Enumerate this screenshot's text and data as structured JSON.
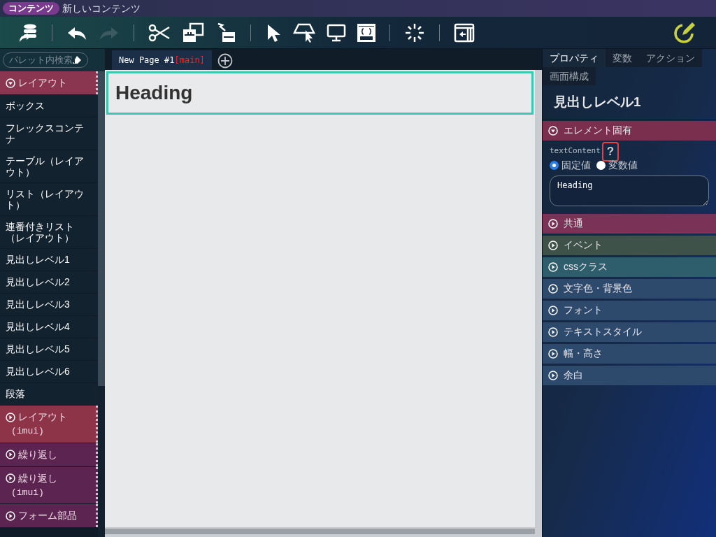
{
  "title_bar": {
    "badge": "コンテンツ",
    "title": "新しいコンテンツ"
  },
  "toolbar": [
    {
      "kind": "export"
    },
    {
      "kind": "separator"
    },
    {
      "kind": "undo",
      "disabled": false
    },
    {
      "kind": "redo",
      "disabled": true
    },
    {
      "kind": "separator"
    },
    {
      "kind": "cut"
    },
    {
      "kind": "copy"
    },
    {
      "kind": "paste"
    },
    {
      "kind": "separator"
    },
    {
      "kind": "pointer"
    },
    {
      "kind": "area-select"
    },
    {
      "kind": "monitor"
    },
    {
      "kind": "css"
    },
    {
      "kind": "separator"
    },
    {
      "kind": "loading"
    },
    {
      "kind": "separator"
    },
    {
      "kind": "panel"
    }
  ],
  "palette": {
    "search_placeholder": "パレット内検索",
    "items": [
      {
        "kind": "category",
        "label": "レイアウト",
        "expanded": true,
        "color": "#8a3650"
      },
      {
        "kind": "item",
        "label": "ボックス"
      },
      {
        "kind": "item",
        "label": "フレックスコンテナ"
      },
      {
        "kind": "item",
        "label": "テーブル（レイアウト）"
      },
      {
        "kind": "item",
        "label": "リスト（レイアウト）"
      },
      {
        "kind": "item",
        "label": "連番付きリスト（レイアウト）"
      },
      {
        "kind": "item",
        "label": "見出しレベル1"
      },
      {
        "kind": "item",
        "label": "見出しレベル2"
      },
      {
        "kind": "item",
        "label": "見出しレベル3"
      },
      {
        "kind": "item",
        "label": "見出しレベル4"
      },
      {
        "kind": "item",
        "label": "見出しレベル5"
      },
      {
        "kind": "item",
        "label": "見出しレベル6"
      },
      {
        "kind": "item",
        "label": "段落"
      },
      {
        "kind": "category",
        "label": "レイアウト",
        "sub": "(imui)",
        "expanded": false,
        "color": "#8d3448"
      },
      {
        "kind": "category",
        "label": "繰り返し",
        "expanded": false,
        "color": "#5c2450"
      },
      {
        "kind": "category",
        "label": "繰り返し",
        "sub": "(imui)",
        "expanded": false,
        "color": "#5c2450"
      },
      {
        "kind": "category",
        "label": "フォーム部品",
        "expanded": false,
        "color": "#5c2450"
      }
    ]
  },
  "page_tab": {
    "name": "New Page #1",
    "tag": "[main]"
  },
  "canvas": {
    "heading": "Heading",
    "selected": true
  },
  "properties": {
    "tabs": [
      {
        "label": "プロパティ",
        "selected": true
      },
      {
        "label": "変数",
        "selected": false
      },
      {
        "label": "アクション",
        "selected": false
      },
      {
        "label": "画面構成",
        "selected": false
      }
    ],
    "element_title": "見出しレベル1",
    "sections": [
      {
        "label": "エレメント固有",
        "expanded": true,
        "color": "#7a2f4e",
        "field": {
          "name": "textContent",
          "help": "?",
          "help_highlighted": true,
          "options": [
            {
              "label": "固定値",
              "selected": true
            },
            {
              "label": "変数値",
              "selected": false
            }
          ],
          "value": "Heading"
        }
      },
      {
        "label": "共通",
        "expanded": false,
        "color": "#7a3356"
      },
      {
        "label": "イベント",
        "expanded": false,
        "color": "#3e524a"
      },
      {
        "label": "cssクラス",
        "expanded": false,
        "color": "#2e5e6c"
      },
      {
        "label": "文字色・背景色",
        "expanded": false,
        "color": "#2d4a6c"
      },
      {
        "label": "フォント",
        "expanded": false,
        "color": "#2d4a6c"
      },
      {
        "label": "テキストスタイル",
        "expanded": false,
        "color": "#2d4a6c"
      },
      {
        "label": "幅・高さ",
        "expanded": false,
        "color": "#2d4a6c"
      },
      {
        "label": "余白",
        "expanded": false,
        "color": "#2d4a6c"
      }
    ]
  }
}
